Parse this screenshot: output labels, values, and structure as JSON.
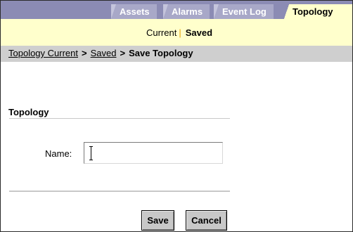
{
  "tabs": [
    {
      "label": "Assets",
      "active": false
    },
    {
      "label": "Alarms",
      "active": false
    },
    {
      "label": "Event Log",
      "active": false
    },
    {
      "label": "Topology",
      "active": true
    }
  ],
  "subnav": {
    "current": "Current",
    "separator": "|",
    "saved": "Saved"
  },
  "breadcrumb": {
    "items": [
      "Topology Current",
      "Saved"
    ],
    "arrow": ">",
    "current": "Save Topology"
  },
  "form": {
    "section_title": "Topology",
    "name_label": "Name:",
    "name_value": "",
    "save_label": "Save",
    "cancel_label": "Cancel"
  },
  "colors": {
    "tabbar": "#8b8bb4",
    "tab": "#a8a8c8",
    "active_tab": "#ffffcc",
    "breadcrumb_bar": "#cfcfcf",
    "separator": "#e8a200"
  }
}
